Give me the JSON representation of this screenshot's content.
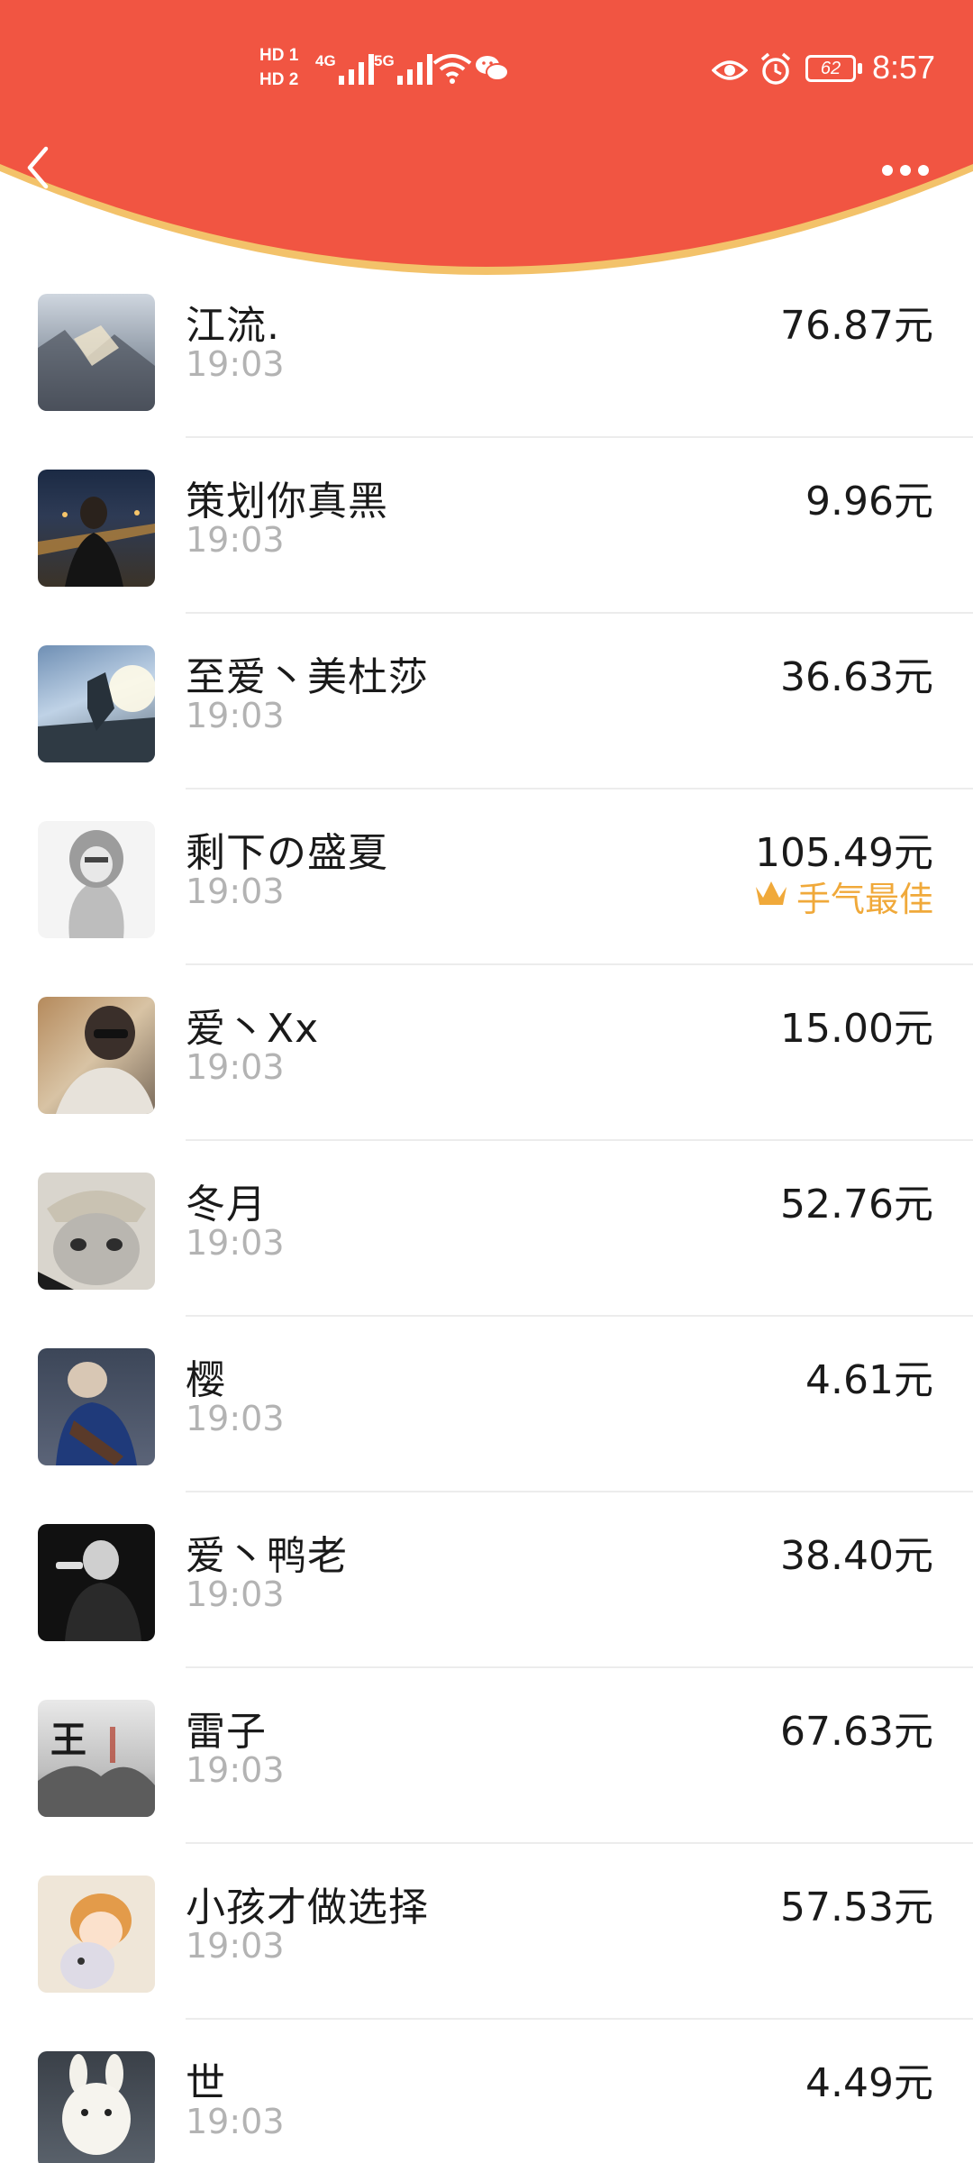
{
  "status_bar": {
    "hd1": "HD 1",
    "hd2": "HD 2",
    "net1": "4G",
    "net2": "5G",
    "battery": "62",
    "time": "8:57"
  },
  "nav": {
    "back_icon": "chevron-left-icon",
    "more_icon": "more-dots-icon"
  },
  "colors": {
    "header_red": "#f15542",
    "header_rim": "#f3c26a",
    "best_gold": "#f0a93a"
  },
  "records": [
    {
      "name": "江流.",
      "time": "19:03",
      "amount": "76.87元",
      "best": ""
    },
    {
      "name": "策划你真黑",
      "time": "19:03",
      "amount": "9.96元",
      "best": ""
    },
    {
      "name": "至爱丶美杜莎",
      "time": "19:03",
      "amount": "36.63元",
      "best": ""
    },
    {
      "name": "剩下の盛夏",
      "time": "19:03",
      "amount": "105.49元",
      "best": "手气最佳"
    },
    {
      "name": "爱丶Xx",
      "time": "19:03",
      "amount": "15.00元",
      "best": ""
    },
    {
      "name": "冬月",
      "time": "19:03",
      "amount": "52.76元",
      "best": ""
    },
    {
      "name": "樱",
      "time": "19:03",
      "amount": "4.61元",
      "best": ""
    },
    {
      "name": "爱丶鸭老",
      "time": "19:03",
      "amount": "38.40元",
      "best": ""
    },
    {
      "name": "雷子",
      "time": "19:03",
      "amount": "67.63元",
      "best": ""
    },
    {
      "name": "小孩才做选择",
      "time": "19:03",
      "amount": "57.53元",
      "best": ""
    },
    {
      "name": "世",
      "time": "19:03",
      "amount": "4.49元",
      "best": ""
    }
  ]
}
